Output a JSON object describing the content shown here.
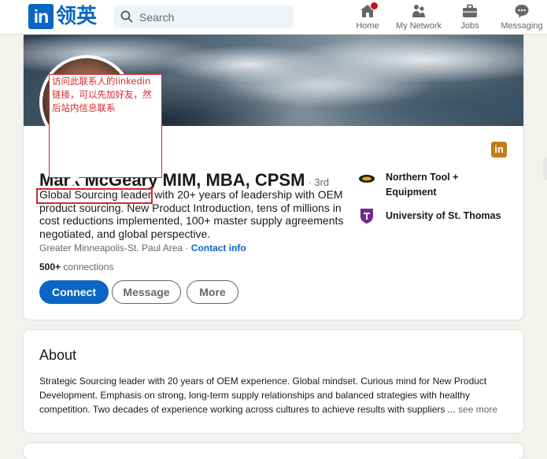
{
  "brand": {
    "logo_mark": "in",
    "logo_text": "领英",
    "accent": "#0a66c2"
  },
  "search": {
    "placeholder": "Search",
    "icon": "search-icon"
  },
  "nav": [
    {
      "label": "Home",
      "icon": "home-icon",
      "has_badge": true
    },
    {
      "label": "My Network",
      "icon": "network-icon"
    },
    {
      "label": "Jobs",
      "icon": "briefcase-icon"
    },
    {
      "label": "Messaging",
      "icon": "messaging-icon"
    }
  ],
  "profile": {
    "name": "Mark McGeary MIM, MBA, CPSM",
    "degree": "· 3rd",
    "headline": "Global Sourcing leader with 20+ years of leadership with OEM product sourcing. New Product Introduction, tens of millions in cost reductions implemented, 100+ master supply agreements negotiated, and global perspective.",
    "location": "Greater Minneapolis-St. Paul Area",
    "location_sep": " · ",
    "contact_link": "Contact info",
    "connections_count": "500+",
    "connections_label": " connections",
    "buttons": {
      "connect": "Connect",
      "message": "Message",
      "more": "More"
    },
    "experience": [
      {
        "name": "Northern Tool + Equipment",
        "icon": "northern-tool-logo"
      },
      {
        "name": "University of St. Thomas",
        "icon": "st-thomas-logo"
      }
    ]
  },
  "about": {
    "title": "About",
    "text": "Strategic Sourcing leader with 20 years of OEM experience. Global mindset. Curious mind for New Product Development. Emphasis on strong, long-term supply relationships and balanced strategies with healthy competition. Two decades of experience working across cultures to achieve results with suppliers",
    "ellipsis": " ...",
    "see_more": "see more"
  },
  "annotation": {
    "note_text": "访问此联系人的linkedin链接，可以先加好友，然后站内信息联系",
    "color": "#d6262c"
  }
}
